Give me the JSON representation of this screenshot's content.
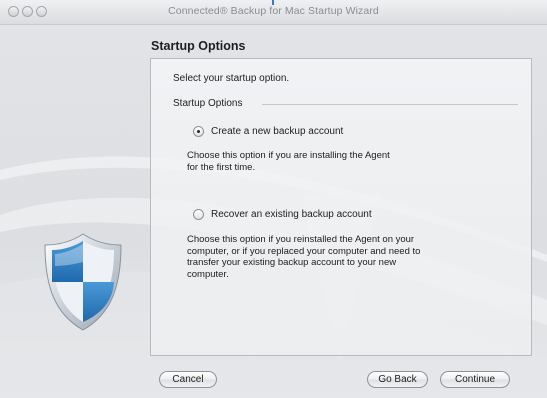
{
  "window": {
    "title": "Connected® Backup for Mac Startup Wizard"
  },
  "page": {
    "heading": "Startup Options",
    "prompt": "Select your startup option.",
    "group_label": "Startup Options"
  },
  "options": [
    {
      "label": "Create a new backup account",
      "selected": true,
      "description": "Choose this option if you are installing the Agent\nfor the first time."
    },
    {
      "label": "Recover an existing backup account",
      "selected": false,
      "description": "Choose this option if you reinstalled the Agent on your\ncomputer, or if you replaced your computer and need to\ntransfer your existing backup account to your new\ncomputer."
    }
  ],
  "buttons": {
    "cancel": "Cancel",
    "back": "Go Back",
    "continue": "Continue"
  },
  "icons": {
    "shield": "shield-icon"
  },
  "colors": {
    "shield_blue": "#2d7fc4",
    "shield_light": "#e8eef4",
    "window_bg": "#dcdee1"
  }
}
